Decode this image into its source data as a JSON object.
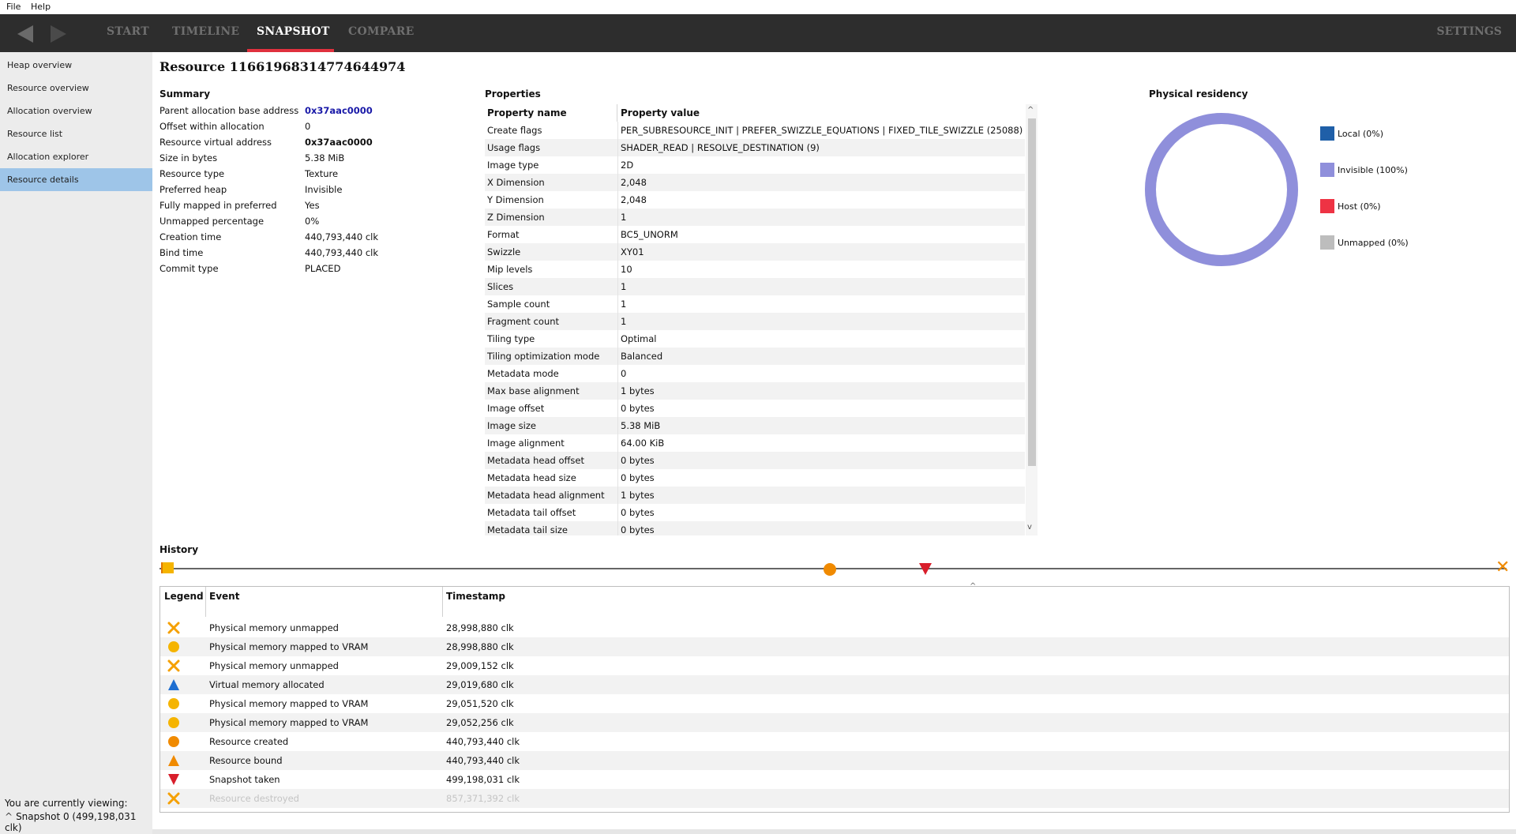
{
  "menu": {
    "file": "File",
    "help": "Help"
  },
  "nav": {
    "tabs": [
      "START",
      "TIMELINE",
      "SNAPSHOT",
      "COMPARE"
    ],
    "active": "SNAPSHOT",
    "settings": "SETTINGS"
  },
  "sidebar": {
    "items": [
      "Heap overview",
      "Resource overview",
      "Allocation overview",
      "Resource list",
      "Allocation explorer",
      "Resource details"
    ],
    "active": "Resource details",
    "viewing_label": "You are currently viewing:",
    "snapshot": "Snapshot 0 (499,198,031 clk)"
  },
  "title": "Resource 11661968314774644974",
  "summary": {
    "label": "Summary",
    "rows": [
      {
        "k": "Parent allocation base address",
        "v": "0x37aac0000"
      },
      {
        "k": "Offset within allocation",
        "v": "0"
      },
      {
        "k": "Resource virtual address",
        "v": "0x37aac0000"
      },
      {
        "k": "Size in bytes",
        "v": "5.38 MiB"
      },
      {
        "k": "Resource type",
        "v": "Texture"
      },
      {
        "k": "Preferred heap",
        "v": "Invisible"
      },
      {
        "k": "Fully mapped in preferred",
        "v": "Yes"
      },
      {
        "k": "Unmapped percentage",
        "v": "0%"
      },
      {
        "k": "Creation time",
        "v": "440,793,440 clk"
      },
      {
        "k": "Bind time",
        "v": "440,793,440 clk"
      },
      {
        "k": "Commit type",
        "v": "PLACED"
      }
    ]
  },
  "properties": {
    "label": "Properties",
    "col_name": "Property name",
    "col_value": "Property value",
    "rows": [
      {
        "k": "Create flags",
        "v": "PER_SUBRESOURCE_INIT | PREFER_SWIZZLE_EQUATIONS | FIXED_TILE_SWIZZLE (25088)"
      },
      {
        "k": "Usage flags",
        "v": "SHADER_READ | RESOLVE_DESTINATION (9)"
      },
      {
        "k": "Image type",
        "v": "2D"
      },
      {
        "k": "X Dimension",
        "v": "2,048"
      },
      {
        "k": "Y Dimension",
        "v": "2,048"
      },
      {
        "k": "Z Dimension",
        "v": "1"
      },
      {
        "k": "Format",
        "v": "BC5_UNORM"
      },
      {
        "k": "Swizzle",
        "v": "XY01"
      },
      {
        "k": "Mip levels",
        "v": "10"
      },
      {
        "k": "Slices",
        "v": "1"
      },
      {
        "k": "Sample count",
        "v": "1"
      },
      {
        "k": "Fragment count",
        "v": "1"
      },
      {
        "k": "Tiling type",
        "v": "Optimal"
      },
      {
        "k": "Tiling optimization mode",
        "v": "Balanced"
      },
      {
        "k": "Metadata mode",
        "v": "0"
      },
      {
        "k": "Max base alignment",
        "v": "1 bytes"
      },
      {
        "k": "Image offset",
        "v": "0 bytes"
      },
      {
        "k": "Image size",
        "v": "5.38 MiB"
      },
      {
        "k": "Image alignment",
        "v": "64.00 KiB"
      },
      {
        "k": "Metadata head offset",
        "v": "0 bytes"
      },
      {
        "k": "Metadata head size",
        "v": "0 bytes"
      },
      {
        "k": "Metadata head alignment",
        "v": "1 bytes"
      },
      {
        "k": "Metadata tail offset",
        "v": "0 bytes"
      },
      {
        "k": "Metadata tail size",
        "v": "0 bytes"
      }
    ]
  },
  "residency": {
    "label": "Physical residency",
    "legend": [
      {
        "label": "Local (0%)",
        "color": "#1f5fa8"
      },
      {
        "label": "Invisible (100%)",
        "color": "#8f8fdb"
      },
      {
        "label": "Host (0%)",
        "color": "#ee3344"
      },
      {
        "label": "Unmapped (0%)",
        "color": "#bdbdbd"
      }
    ],
    "invisible_fraction": 1.0
  },
  "history": {
    "label": "History",
    "col_legend": "Legend",
    "col_event": "Event",
    "col_timestamp": "Timestamp",
    "rows": [
      {
        "icon": "x-orange-icon",
        "event": "Physical memory unmapped",
        "ts": "28,998,880 clk"
      },
      {
        "icon": "circle-yellow-icon",
        "event": "Physical memory mapped to VRAM",
        "ts": "28,998,880 clk"
      },
      {
        "icon": "x-orange-icon",
        "event": "Physical memory unmapped",
        "ts": "29,009,152 clk"
      },
      {
        "icon": "triangle-blue-icon",
        "event": "Virtual memory allocated",
        "ts": "29,019,680 clk"
      },
      {
        "icon": "circle-yellow-icon",
        "event": "Physical memory mapped to VRAM",
        "ts": "29,051,520 clk"
      },
      {
        "icon": "circle-yellow-icon",
        "event": "Physical memory mapped to VRAM",
        "ts": "29,052,256 clk"
      },
      {
        "icon": "circle-orange-icon",
        "event": "Resource created",
        "ts": "440,793,440 clk"
      },
      {
        "icon": "triangle-orange-icon",
        "event": "Resource bound",
        "ts": "440,793,440 clk"
      },
      {
        "icon": "triangle-down-red-icon",
        "event": "Snapshot taken",
        "ts": "499,198,031 clk"
      },
      {
        "icon": "x-orange-icon",
        "event": "Resource destroyed",
        "ts": "857,371,392 clk"
      }
    ]
  },
  "colors": {
    "accent": "#e0313e",
    "nav_bg": "#2d2d2d",
    "selected": "#9ec5e8",
    "invisible": "#8f8fdb"
  }
}
